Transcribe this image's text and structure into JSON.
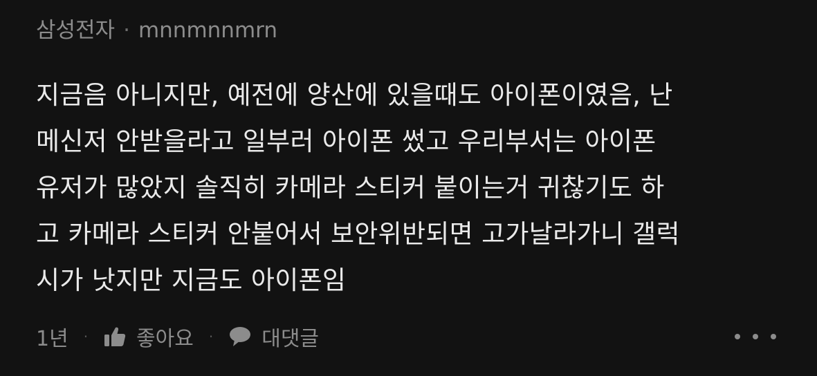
{
  "comment": {
    "company": "삼성전자",
    "separator": "·",
    "username": "mnnmnnmrn",
    "body_lines": [
      "지금음 아니지만, 예전에 양산에 있을때도 아이폰이였음, 난",
      "메신저 안받을라고 일부러 아이폰 썼고 우리부서는 아이폰",
      "유저가 많았지 솔직히 카메라 스티커 붙이는거 귀찮기도 하",
      "고 카메라 스티커 안붙어서 보안위반되면 고가날라가니 갤럭",
      "시가 낫지만 지금도 아이폰임"
    ]
  },
  "footer": {
    "time": "1년",
    "like_label": "좋아요",
    "reply_label": "대댓글",
    "like_icon": "thumbs-up-icon",
    "reply_icon": "speech-bubble-icon",
    "more_icon": "more-dots-icon"
  }
}
